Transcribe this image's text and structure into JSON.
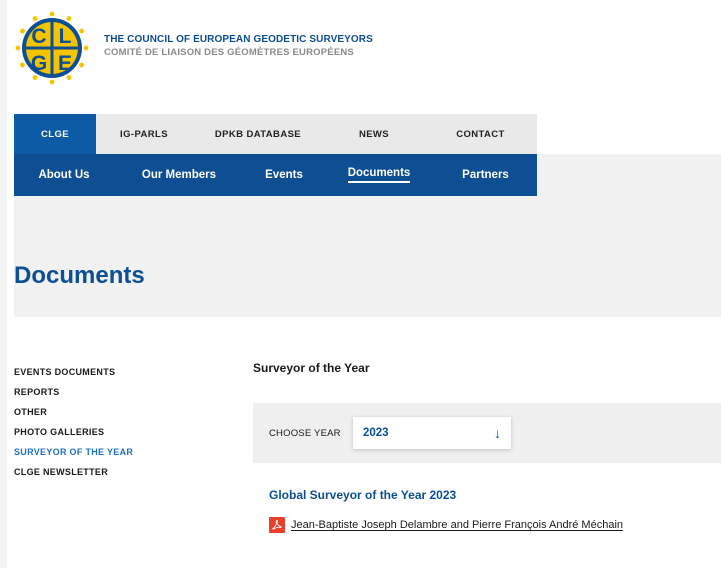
{
  "header": {
    "org_name_en": "THE COUNCIL OF EUROPEAN GEODETIC SURVEYORS",
    "org_name_fr": "COMITÉ DE LIAISON DES GÉOMÈTRES EUROPÉENS",
    "logo_icon": "clge-logo-icon",
    "logo_letters": [
      "C",
      "L",
      "G",
      "E"
    ]
  },
  "nav_top": [
    {
      "label": "CLGE",
      "active": true
    },
    {
      "label": "IG-PARLS",
      "active": false
    },
    {
      "label": "DPKB DATABASE",
      "active": false
    },
    {
      "label": "NEWS",
      "active": false
    },
    {
      "label": "CONTACT",
      "active": false
    }
  ],
  "nav_sub": [
    {
      "label": "About Us",
      "active": false
    },
    {
      "label": "Our Members",
      "active": false
    },
    {
      "label": "Events",
      "active": false
    },
    {
      "label": "Documents",
      "active": true
    },
    {
      "label": "Partners",
      "active": false
    }
  ],
  "page_title": "Documents",
  "sidebar": [
    {
      "label": "EVENTS DOCUMENTS",
      "active": false
    },
    {
      "label": "REPORTS",
      "active": false
    },
    {
      "label": "OTHER",
      "active": false
    },
    {
      "label": "PHOTO GALLERIES",
      "active": false
    },
    {
      "label": "SURVEYOR OF THE YEAR",
      "active": true
    },
    {
      "label": "CLGE NEWSLETTER",
      "active": false
    }
  ],
  "main": {
    "section_title": "Surveyor of the Year",
    "choose_year_label": "CHOOSE YEAR",
    "selected_year": "2023",
    "global_title": "Global Surveyor of the Year 2023",
    "document_link": "Jean-Baptiste Joseph Delambre and Pierre François André Méchain",
    "document_icon": "pdf-icon"
  },
  "colors": {
    "brand_blue": "#0d4f92",
    "active_blue": "#0d5aa5",
    "link_blue": "#1d6fc1",
    "logo_yellow": "#f5c400",
    "pdf_red": "#e5412c"
  }
}
